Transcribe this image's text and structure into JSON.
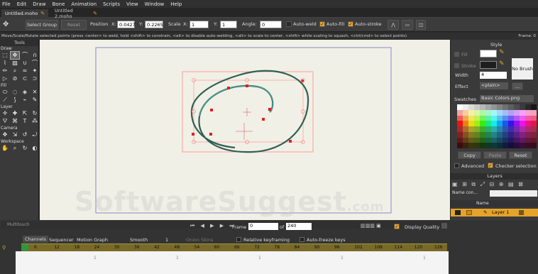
{
  "menu": [
    "File",
    "Edit",
    "Draw",
    "Bone",
    "Animation",
    "Scripts",
    "View",
    "Window",
    "Help"
  ],
  "tabs": [
    {
      "label": "Untitled.moho"
    },
    {
      "label": "Untitled 2.moho"
    }
  ],
  "toolbar": {
    "select_group": "Select Group",
    "reset": "Reset",
    "position": "Position",
    "x_label": "X:",
    "x_val": "0.0427",
    "y_label": "Y:",
    "y_val": "0.2265",
    "scale": "Scale",
    "sx_label": "X:",
    "sx_val": "1",
    "sy_label": "Y:",
    "sy_val": "1",
    "angle": "Angle:",
    "angle_val": "0",
    "auto_weld": "Auto-weld",
    "auto_fill": "Auto-fill",
    "auto_stroke": "Auto-stroke"
  },
  "status": "Move/Scale/Rotate selected points (press <enter> to weld, hold <shift> to constrain, <alt> to disable auto-welding, <alt> to scale to center, <shift> while scaling to squash, <ctrl/cmd> to select points)",
  "frame_status": "Frame: 0",
  "left": {
    "title": "Tools",
    "draw": "Draw",
    "fill": "Fill",
    "layer": "Layer",
    "camera": "Camera",
    "workspace": "Workspace"
  },
  "style": {
    "title": "Style",
    "fill": "Fill",
    "stroke": "Stroke",
    "width": "Width",
    "width_val": "4",
    "effect": "Effect",
    "effect_val": "<plain>",
    "no_brush": "No Brush",
    "swatches": "Swatches",
    "swatch_file": "Basic Colors.png",
    "copy": "Copy",
    "paste": "Paste",
    "reset": "Reset",
    "advanced": "Advanced",
    "checker": "Checker selection"
  },
  "layers": {
    "title": "Layers",
    "name_col": "Name con...",
    "name_header": "Name",
    "layer1": "Layer 1"
  },
  "timeline": {
    "multitouch": "Multitouch",
    "frame_label": "Frame",
    "frame_val": "0",
    "of": "of",
    "total": "240",
    "display_quality": "Display Quality",
    "tabs": [
      "Channels",
      "Sequencer",
      "Motion Graph"
    ],
    "smooth": "Smooth",
    "one": "1",
    "onion": "Onion Skins",
    "relative": "Relative keyframing",
    "autofreeze": "Auto-freeze keys",
    "ticks": [
      "6",
      "12",
      "18",
      "24",
      "30",
      "36",
      "42",
      "48",
      "54",
      "60",
      "66",
      "72",
      "78",
      "84",
      "90",
      "96",
      "102",
      "108",
      "114",
      "120",
      "126"
    ],
    "track_marks": [
      "1",
      "1",
      "1",
      "1",
      "1"
    ]
  },
  "watermark": "SoftwareSuggest",
  "watermark_tld": ".com",
  "colors": {
    "accent": "#e5a32a",
    "canvas": "#f1f0e6",
    "frame": "#8888cc",
    "curve": "#2f5f55",
    "selection": "#ff8080"
  }
}
